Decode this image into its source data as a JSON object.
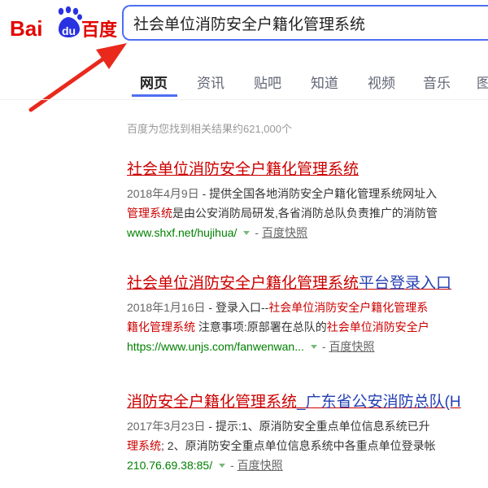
{
  "logo": {
    "left_text": "Bai",
    "badge_text": "du",
    "right_text": "百度"
  },
  "search": {
    "query": "社会单位消防安全户籍化管理系统"
  },
  "tabs": [
    {
      "label": "网页",
      "active": true
    },
    {
      "label": "资讯",
      "active": false
    },
    {
      "label": "贴吧",
      "active": false
    },
    {
      "label": "知道",
      "active": false
    },
    {
      "label": "视频",
      "active": false
    },
    {
      "label": "音乐",
      "active": false
    },
    {
      "label": "图",
      "active": false
    }
  ],
  "stats": "百度为您找到相关结果约621,000个",
  "results": [
    {
      "title_main": "社会单位消防安全户籍化管理系统",
      "title_tail": "",
      "date": "2018年4月9日",
      "line1_rest": " - 提供全国各地消防安全户籍化管理系统网址入",
      "line2_hl": "管理系统",
      "line2_rest": "是由公安消防局研发,各省消防总队负责推广的消防管",
      "url": "www.shxf.net/hujihua/",
      "cache": "百度快照"
    },
    {
      "title_main": "社会单位消防安全户籍化管理系统",
      "title_tail": "平台登录入口",
      "date": "2018年1月16日",
      "line1_rest": " - 登录入口--",
      "line1_hl": "社会单位消防安全户籍化管理系",
      "line2_hl": "籍化管理系统",
      "line2_rest": " 注意事项:原部署在总队的",
      "line2_hl2": "社会单位消防安全户",
      "url": "https://www.unjs.com/fanwenwan...",
      "cache": "百度快照"
    },
    {
      "title_main": "消防安全户籍化管理系统",
      "title_tail": "_广东省公安消防总队(H",
      "date": "2017年3月23日",
      "line1_rest": " - 提示:1、原消防安全重点单位信息系统已升",
      "line2_hl": "理系统",
      "line2_rest": "; 2、原消防安全重点单位信息系统中各重点单位登录帐",
      "url": "210.76.69.38:85/",
      "cache": "百度快照"
    }
  ],
  "separator": "-",
  "colors": {
    "brand_red": "#e10601",
    "brand_blue": "#2932e1",
    "link": "#2440b3",
    "highlight": "#cc0000",
    "url": "#008000",
    "arrow": "#e8291c"
  }
}
